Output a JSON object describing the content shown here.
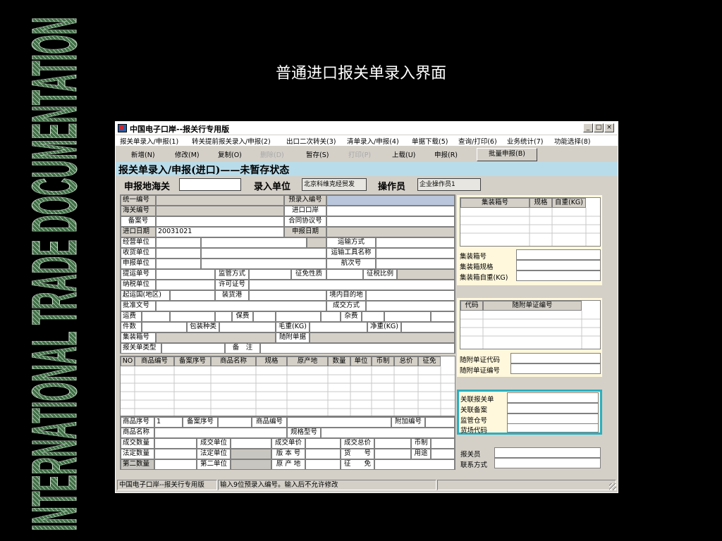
{
  "side_banner": "INTERNATIONAL TRADE DOCUMENTATION",
  "slide_title": "普通进口报关单录入界面",
  "window": {
    "title": "中国电子口岸--报关行专用版",
    "controls": [
      "_",
      "□",
      "×"
    ]
  },
  "menu": [
    "报关单录入/申报(1)",
    "转关提前报关录入/申报(2)",
    "出口二次转关(3)",
    "清单录入/申报(4)",
    "单据下载(5)",
    "查询/打印(6)",
    "业务统计(7)",
    "功能选择(8)"
  ],
  "toolbar": {
    "new": "新增(N)",
    "edit": "修改(M)",
    "copy": "复制(O)",
    "delete": "删除(D)",
    "save": "暂存(S)",
    "print": "打印(P)",
    "upload": "上载(U)",
    "declare": "申报(R)",
    "batch": "批量申报(B)"
  },
  "form_status": "报关单录入/申报(进口)——未暂存状态",
  "declare_row": {
    "customs_label": "申报地海关",
    "customs_value": "",
    "unit_label": "录入单位",
    "unit_value": "北京科维克经贸发",
    "operator_label": "操作员",
    "operator_value": "企业操作员1"
  },
  "form": {
    "uniform_no": "统一编号",
    "preentry_no": "预录入编号",
    "customs_no": "海关编号",
    "import_port": "进口口岸",
    "record_no": "备案号",
    "contract_no": "合同协议号",
    "import_date": "进口日期",
    "import_date_value": "20031021",
    "declare_date": "申报日期",
    "business_unit": "经营单位",
    "transport_mode": "运输方式",
    "consignee": "收货单位",
    "transport_name": "运输工具名称",
    "declare_unit": "申报单位",
    "voyage_no": "航次号",
    "bill_no": "提运单号",
    "supervision": "监管方式",
    "tax_nature": "征免性质",
    "tax_ratio": "征税比例",
    "taxpayer": "纳税单位",
    "license_no": "许可证号",
    "origin_country": "起运国(地区)",
    "loading_port": "装货港",
    "destination": "境内目的地",
    "approval_no": "批准文号",
    "deal_mode": "成交方式",
    "freight": "运费",
    "insurance": "保费",
    "misc": "杂费",
    "packages": "件数",
    "package_type": "包装种类",
    "gross_weight": "毛重(KG)",
    "net_weight": "净重(KG)",
    "container_no": "集装箱号",
    "attached_docs": "随附单据",
    "declaration_type": "报关单类型",
    "remarks": "备　注"
  },
  "goods_table": {
    "headers": [
      "NO",
      "商品编号",
      "备案序号",
      "商品名称",
      "规格",
      "原产地",
      "数量",
      "单位",
      "币制",
      "总价",
      "征免"
    ]
  },
  "goods_detail": {
    "item_no": "商品序号",
    "item_no_value": "1",
    "record_seq": "备案序号",
    "goods_code": "商品编号",
    "extra_code": "附加编号",
    "goods_name": "商品名称",
    "spec_model": "规格型号",
    "deal_qty": "成交数量",
    "deal_unit": "成交单位",
    "unit_price": "成交单价",
    "total_price": "成交总价",
    "currency": "币制",
    "legal_qty": "法定数量",
    "legal_unit": "法定单位",
    "version_no": "版 本 号",
    "goods_no": "货　　号",
    "purpose": "用途",
    "second_qty": "第二数量",
    "second_unit": "第二单位",
    "origin": "原 产 地",
    "exemption": "征　　免"
  },
  "container_panel": {
    "headers": [
      "集装箱号",
      "规格",
      "自重(KG)"
    ],
    "container_no": "集装箱号",
    "container_spec": "集装箱规格",
    "container_weight": "集装箱自重(KG)"
  },
  "docs_panel": {
    "headers": [
      "代码",
      "随附单证编号"
    ],
    "doc_code": "随附单证代码",
    "doc_no": "随附单证编号"
  },
  "related_panel": {
    "related_decl": "关联报关单",
    "related_record": "关联备案",
    "bonded_warehouse": "监管仓号",
    "yard_code": "货场代码"
  },
  "contact_panel": {
    "declarant": "报关员",
    "contact": "联系方式"
  },
  "statusbar": {
    "app": "中国电子口岸--报关行专用版",
    "hint": "输入9位预录入编号。输入后不允许修改"
  }
}
